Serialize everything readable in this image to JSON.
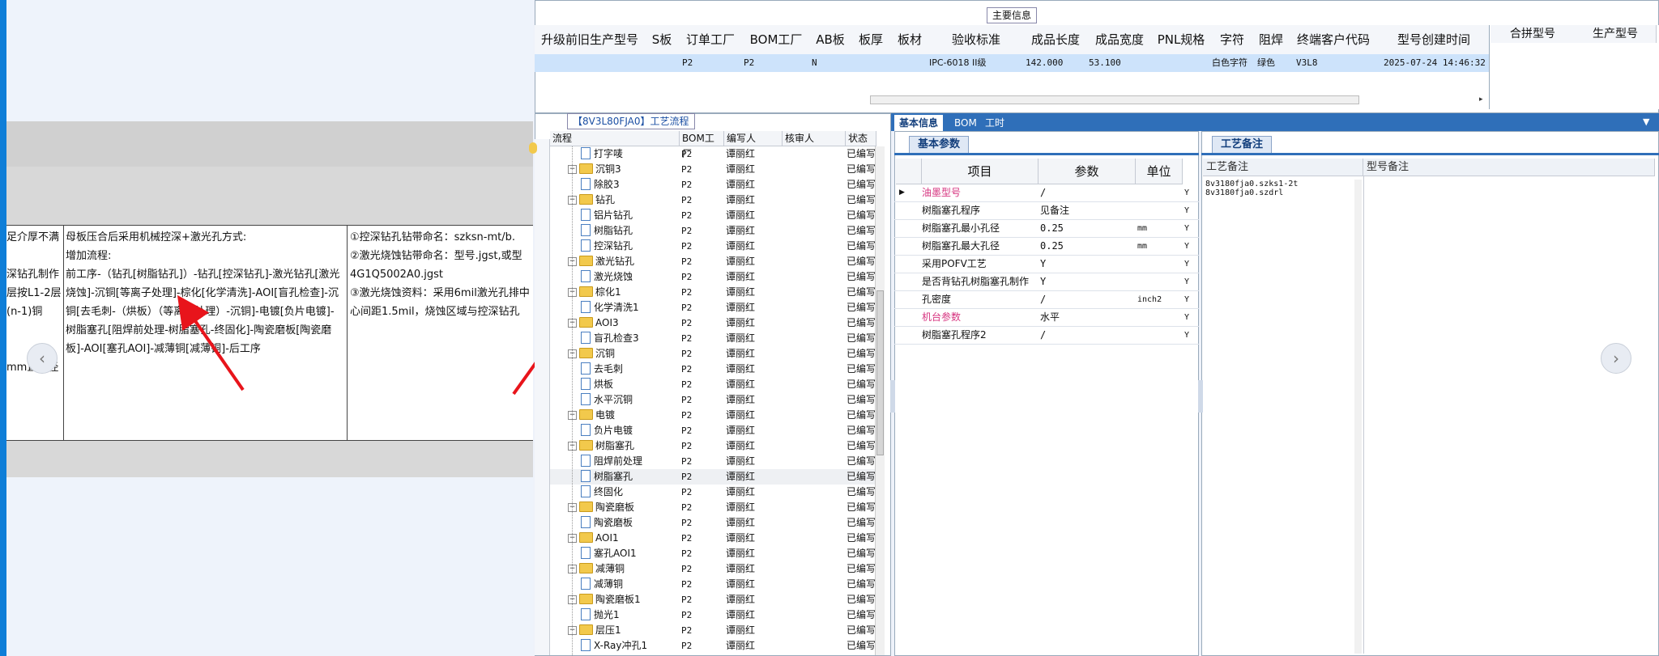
{
  "document": {
    "left_cut_text": "足介厚不满\n\n深钻孔制作\n层按L1-2层\n(n-1)铜\n\n\nmm直刀径",
    "middle_text": "母板压合后采用机械控深+激光孔方式:\n增加流程:\n前工序-（钻孔[树脂钻孔]）-钻孔[控深钻孔]-激光钻孔[激光烧蚀]-沉铜[等离子处理]-棕化[化学清洗]-AOI[盲孔检查]-沉铜[去毛刺-（烘板）（等离子处理）-沉铜]-电镀[负片电镀]-树脂塞孔[阻焊前处理-树脂塞孔-终固化]-陶瓷磨板[陶瓷磨板]-AOI[塞孔AOI]-减薄铜[减薄铜]-后工序",
    "right_text": "①控深钻孔钻带命名：szksn-mt/b.\n②激光烧蚀钻带命名：型号.jgst,或型4G1Q5002A0.jgst\n③激光烧蚀资料：采用6mil激光孔排中心间距1.5mil，烧蚀区域与控深钻孔"
  },
  "main_info": {
    "legend": "主要信息",
    "headers": [
      "升级前旧生产型号",
      "S板",
      "订单工厂",
      "BOM工厂",
      "AB板",
      "板厚",
      "板材",
      "验收标准",
      "成品长度",
      "成品宽度",
      "PNL规格",
      "字符",
      "阻焊",
      "终端客户代码",
      "型号创建时间"
    ],
    "row": {
      "order_factory": "P2",
      "bom_factory": "P2",
      "ab_board": "N",
      "acceptance_std": "IPC-6018 II级",
      "length": "142.000",
      "width": "53.100",
      "character": "白色字符",
      "solder_mask": "绿色",
      "customer_code": "V3L8",
      "created": "2025-07-24 14:46:32"
    },
    "right_headers": [
      "合拼型号",
      "生产型号"
    ]
  },
  "process_tree": {
    "legend": "【8V3L80FJA0】工艺流程",
    "headers": [
      "流程",
      "BOM工厂",
      "编写人",
      "核审人",
      "状态"
    ],
    "rows": [
      {
        "name": "打字唛",
        "kind": "doc",
        "factory": "P2",
        "writer": "谭丽红",
        "status": "已编写"
      },
      {
        "name": "沉铜3",
        "kind": "folder",
        "factory": "P2",
        "writer": "谭丽红",
        "status": "已编写"
      },
      {
        "name": "除胶3",
        "kind": "doc",
        "factory": "P2",
        "writer": "谭丽红",
        "status": "已编写"
      },
      {
        "name": "钻孔",
        "kind": "folder",
        "factory": "P2",
        "writer": "谭丽红",
        "status": "已编写"
      },
      {
        "name": "铝片钻孔",
        "kind": "doc",
        "factory": "P2",
        "writer": "谭丽红",
        "status": "已编写"
      },
      {
        "name": "树脂钻孔",
        "kind": "doc",
        "factory": "P2",
        "writer": "谭丽红",
        "status": "已编写"
      },
      {
        "name": "控深钻孔",
        "kind": "doc",
        "factory": "P2",
        "writer": "谭丽红",
        "status": "已编写"
      },
      {
        "name": "激光钻孔",
        "kind": "folder",
        "factory": "P2",
        "writer": "谭丽红",
        "status": "已编写"
      },
      {
        "name": "激光烧蚀",
        "kind": "doc",
        "factory": "P2",
        "writer": "谭丽红",
        "status": "已编写"
      },
      {
        "name": "棕化1",
        "kind": "folder",
        "factory": "P2",
        "writer": "谭丽红",
        "status": "已编写"
      },
      {
        "name": "化学清洗1",
        "kind": "doc",
        "factory": "P2",
        "writer": "谭丽红",
        "status": "已编写"
      },
      {
        "name": "AOI3",
        "kind": "folder",
        "factory": "P2",
        "writer": "谭丽红",
        "status": "已编写"
      },
      {
        "name": "盲孔检查3",
        "kind": "doc",
        "factory": "P2",
        "writer": "谭丽红",
        "status": "已编写"
      },
      {
        "name": "沉铜",
        "kind": "folder",
        "factory": "P2",
        "writer": "谭丽红",
        "status": "已编写"
      },
      {
        "name": "去毛刺",
        "kind": "doc",
        "factory": "P2",
        "writer": "谭丽红",
        "status": "已编写"
      },
      {
        "name": "烘板",
        "kind": "doc",
        "factory": "P2",
        "writer": "谭丽红",
        "status": "已编写"
      },
      {
        "name": "水平沉铜",
        "kind": "doc",
        "factory": "P2",
        "writer": "谭丽红",
        "status": "已编写"
      },
      {
        "name": "电镀",
        "kind": "folder",
        "factory": "P2",
        "writer": "谭丽红",
        "status": "已编写"
      },
      {
        "name": "负片电镀",
        "kind": "doc",
        "factory": "P2",
        "writer": "谭丽红",
        "status": "已编写"
      },
      {
        "name": "树脂塞孔",
        "kind": "folder",
        "factory": "P2",
        "writer": "谭丽红",
        "status": "已编写"
      },
      {
        "name": "阻焊前处理",
        "kind": "doc",
        "factory": "P2",
        "writer": "谭丽红",
        "status": "已编写"
      },
      {
        "name": "树脂塞孔",
        "kind": "doc",
        "factory": "P2",
        "writer": "谭丽红",
        "status": "已编写"
      },
      {
        "name": "终固化",
        "kind": "doc",
        "factory": "P2",
        "writer": "谭丽红",
        "status": "已编写"
      },
      {
        "name": "陶瓷磨板",
        "kind": "folder",
        "factory": "P2",
        "writer": "谭丽红",
        "status": "已编写"
      },
      {
        "name": "陶瓷磨板",
        "kind": "doc",
        "factory": "P2",
        "writer": "谭丽红",
        "status": "已编写"
      },
      {
        "name": "AOI1",
        "kind": "folder",
        "factory": "P2",
        "writer": "谭丽红",
        "status": "已编写"
      },
      {
        "name": "塞孔AOI1",
        "kind": "doc",
        "factory": "P2",
        "writer": "谭丽红",
        "status": "已编写"
      },
      {
        "name": "减薄铜",
        "kind": "folder",
        "factory": "P2",
        "writer": "谭丽红",
        "status": "已编写"
      },
      {
        "name": "减薄铜",
        "kind": "doc",
        "factory": "P2",
        "writer": "谭丽红",
        "status": "已编写"
      },
      {
        "name": "陶瓷磨板1",
        "kind": "folder",
        "factory": "P2",
        "writer": "谭丽红",
        "status": "已编写"
      },
      {
        "name": "抛光1",
        "kind": "doc",
        "factory": "P2",
        "writer": "谭丽红",
        "status": "已编写"
      },
      {
        "name": "层压1",
        "kind": "folder",
        "factory": "P2",
        "writer": "谭丽红",
        "status": "已编写"
      },
      {
        "name": "X-Ray冲孔1",
        "kind": "doc",
        "factory": "P2",
        "writer": "谭丽红",
        "status": "已编写"
      }
    ]
  },
  "info_tabs": [
    "基本信息",
    "BOM",
    "工时"
  ],
  "basic_params": {
    "subtab": "基本参数",
    "headers": [
      "项目",
      "参数",
      "单位"
    ],
    "rows": [
      {
        "name": "油墨型号",
        "value": "/",
        "unit": "",
        "flag": "Y",
        "highlight": true
      },
      {
        "name": "树脂塞孔程序",
        "value": "见备注",
        "unit": "",
        "flag": "Y",
        "highlight": false
      },
      {
        "name": "树脂塞孔最小孔径",
        "value": "0.25",
        "unit": "mm",
        "flag": "Y",
        "highlight": false
      },
      {
        "name": "树脂塞孔最大孔径",
        "value": "0.25",
        "unit": "mm",
        "flag": "Y",
        "highlight": false
      },
      {
        "name": "采用POFV工艺",
        "value": "Y",
        "unit": "",
        "flag": "Y",
        "highlight": false
      },
      {
        "name": "是否背钻孔树脂塞孔制作",
        "value": "Y",
        "unit": "",
        "flag": "Y",
        "highlight": false
      },
      {
        "name": "孔密度",
        "value": "/",
        "unit": "inch2",
        "flag": "Y",
        "highlight": false
      },
      {
        "name": "机台参数",
        "value": "水平",
        "unit": "",
        "flag": "Y",
        "highlight": true
      },
      {
        "name": "树脂塞孔程序2",
        "value": "/",
        "unit": "",
        "flag": "Y",
        "highlight": false
      }
    ]
  },
  "remarks": {
    "subtab": "工艺备注",
    "headers": [
      "工艺备注",
      "型号备注"
    ],
    "lines": [
      "8v3180fja0.szks1-2t",
      "8v3180fja0.szdrl"
    ]
  },
  "colors": {
    "accent": "#2f6fb9",
    "highlight_text": "#d6337f",
    "selected_row": "#cde3fb",
    "left_strip": "#0e7ed8",
    "arrow": "#e8141b"
  }
}
